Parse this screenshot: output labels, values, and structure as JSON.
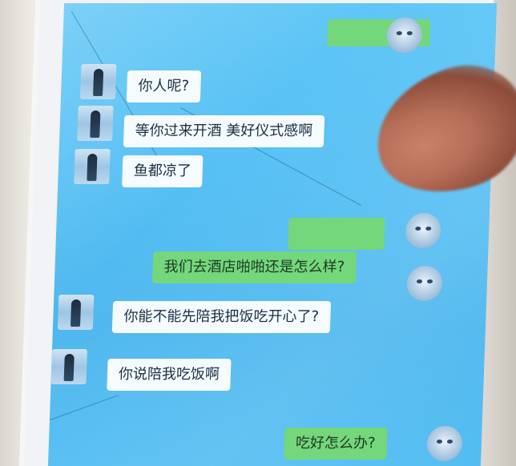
{
  "chat": {
    "messages": [
      {
        "side": "in",
        "text": "你人呢?"
      },
      {
        "side": "in",
        "text": "等你过来开酒 美好仪式感啊"
      },
      {
        "side": "in",
        "text": "鱼都凉了"
      },
      {
        "side": "out",
        "text": "我们去酒店啪啪还是怎么样?"
      },
      {
        "side": "in",
        "text": "你能不能先陪我把饭吃开心了?"
      },
      {
        "side": "in",
        "text": "你说陪我吃饭啊"
      },
      {
        "side": "out",
        "text": "吃好怎么办?"
      }
    ]
  },
  "colors": {
    "screen_bg": "#56c0f4",
    "incoming_bubble": "#f6fbff",
    "outgoing_bubble": "#74d77c"
  },
  "icons": {
    "contact_avatar": "person-photo-avatar",
    "user_avatar": "dog-face-avatar"
  }
}
